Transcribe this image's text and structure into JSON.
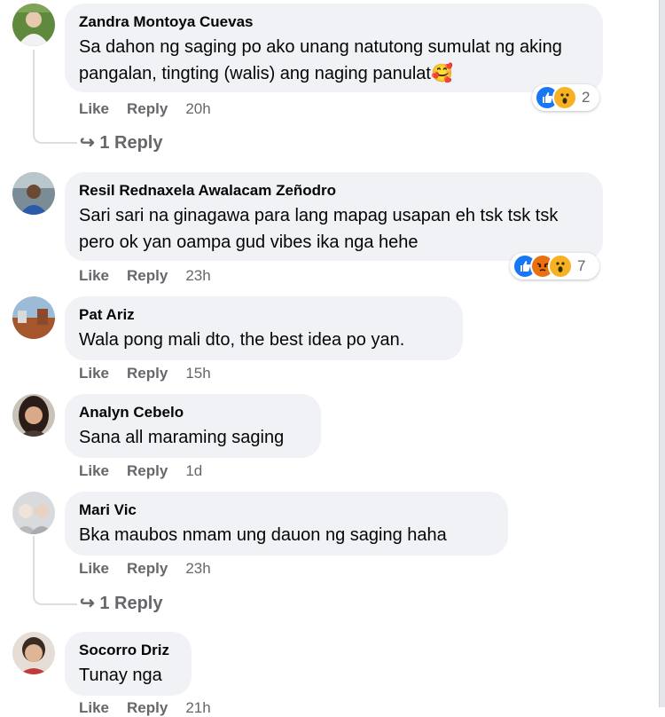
{
  "comments": [
    {
      "author": "Zandra Montoya Cuevas",
      "text": "Sa dahon ng saging po ako unang natutong sumulat ng aking pangalan, tingting (walis) ang naging panulat🥰",
      "like_label": "Like",
      "reply_label": "Reply",
      "time": "20h",
      "reaction_count": "2",
      "reactions": [
        "like-icon",
        "wow-icon"
      ],
      "view_replies": "1 Reply"
    },
    {
      "author": "Resil Rednaxela Awalacam Zeñodro",
      "text": "Sari sari na ginagawa para lang mapag usapan eh tsk tsk tsk pero ok yan oampa gud vibes ika nga hehe",
      "like_label": "Like",
      "reply_label": "Reply",
      "time": "23h",
      "reaction_count": "7",
      "reactions": [
        "like-icon",
        "angry-icon",
        "wow-icon"
      ]
    },
    {
      "author": "Pat Ariz",
      "text": "Wala pong mali dto, the best idea po yan.",
      "like_label": "Like",
      "reply_label": "Reply",
      "time": "15h"
    },
    {
      "author": "Analyn Cebelo",
      "text": "Sana all maraming saging",
      "like_label": "Like",
      "reply_label": "Reply",
      "time": "1d"
    },
    {
      "author": "Mari Vic",
      "text": "Bka maubos nmam ung dauon ng saging haha",
      "like_label": "Like",
      "reply_label": "Reply",
      "time": "23h",
      "view_replies": "1 Reply"
    },
    {
      "author": "Socorro Driz",
      "text": "Tunay nga",
      "like_label": "Like",
      "reply_label": "Reply",
      "time": "21h"
    }
  ],
  "colors": {
    "bubble": "#f0f2f5",
    "secondary_text": "#65676b",
    "like_blue": "#1877f2",
    "wow_yellow": "#f7b125",
    "angry_orange": "#e9710f"
  }
}
